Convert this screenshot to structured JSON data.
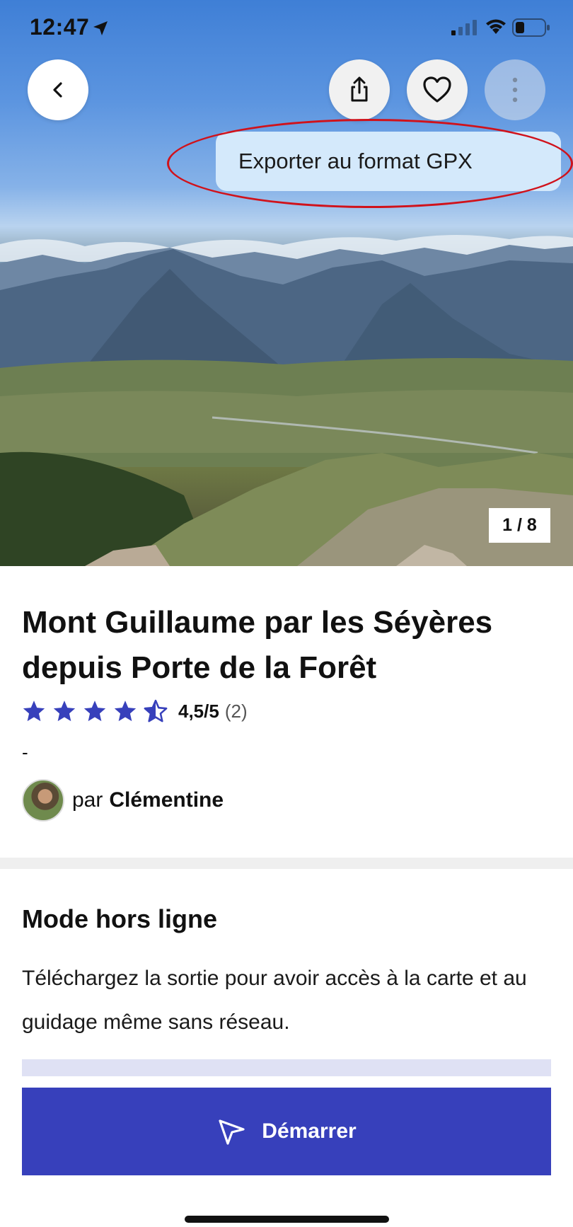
{
  "status_bar": {
    "time": "12:47",
    "icons": [
      "location-arrow-icon",
      "cellular-signal-icon",
      "wifi-icon",
      "battery-icon"
    ]
  },
  "header": {
    "back_icon": "chevron-left-icon",
    "share_icon": "share-icon",
    "favorite_icon": "heart-icon",
    "more_icon": "vertical-dots-icon"
  },
  "menu": {
    "items": [
      {
        "label": "Exporter au format GPX"
      }
    ]
  },
  "gallery": {
    "counter": "1 / 8"
  },
  "hike": {
    "title": "Mont Guillaume par les Séyères depuis Porte de la Forêt",
    "rating": {
      "value": "4,5/5",
      "count": "(2)",
      "stars": 4.5
    },
    "subtitle": "-",
    "author": {
      "prefix": "par",
      "name": "Clémentine"
    }
  },
  "offline": {
    "title": "Mode hors ligne",
    "description": "Téléchargez la sortie pour avoir accès à la carte et au guidage même sans réseau."
  },
  "actions": {
    "start_label": "Démarrer",
    "start_icon": "navigation-arrow-icon"
  },
  "colors": {
    "accent": "#3740bb",
    "star": "#3740bb",
    "menu_background": "#d4e9fb",
    "annotation": "#d0121b"
  }
}
